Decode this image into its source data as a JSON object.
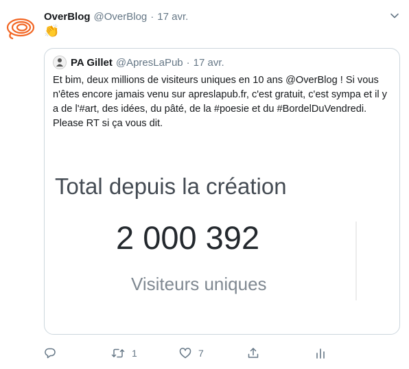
{
  "tweet": {
    "author_name": "OverBlog",
    "author_handle": "@OverBlog",
    "separator": "·",
    "date": "17 avr.",
    "text": "👏",
    "avatar_icon": "overblog-logo",
    "menu_icon": "chevron-down-icon"
  },
  "quoted_tweet": {
    "author_name": "PA Gillet",
    "author_handle": "@ApresLaPub",
    "separator": "·",
    "date": "17 avr.",
    "text": "Et bim, deux millions de visiteurs uniques en 10 ans @OverBlog ! Si vous n'êtes encore jamais venu sur apreslapub.fr, c'est gratuit, c'est sympa et il y a de l'#art, des idées, du pâté, de la #poesie et du #BordelDuVendredi. Please RT si ça vous dit.",
    "image": {
      "title": "Total depuis la création",
      "number": "2 000 392",
      "label": "Visiteurs uniques"
    }
  },
  "actions": {
    "reply": {
      "icon": "reply-icon",
      "count": ""
    },
    "retweet": {
      "icon": "retweet-icon",
      "count": "1"
    },
    "like": {
      "icon": "heart-icon",
      "count": "7"
    },
    "share": {
      "icon": "share-icon",
      "count": ""
    },
    "analytics": {
      "icon": "analytics-icon",
      "count": ""
    }
  },
  "colors": {
    "brand_orange": "#f26522",
    "secondary_text": "#657786",
    "border": "#ccd6dd"
  }
}
